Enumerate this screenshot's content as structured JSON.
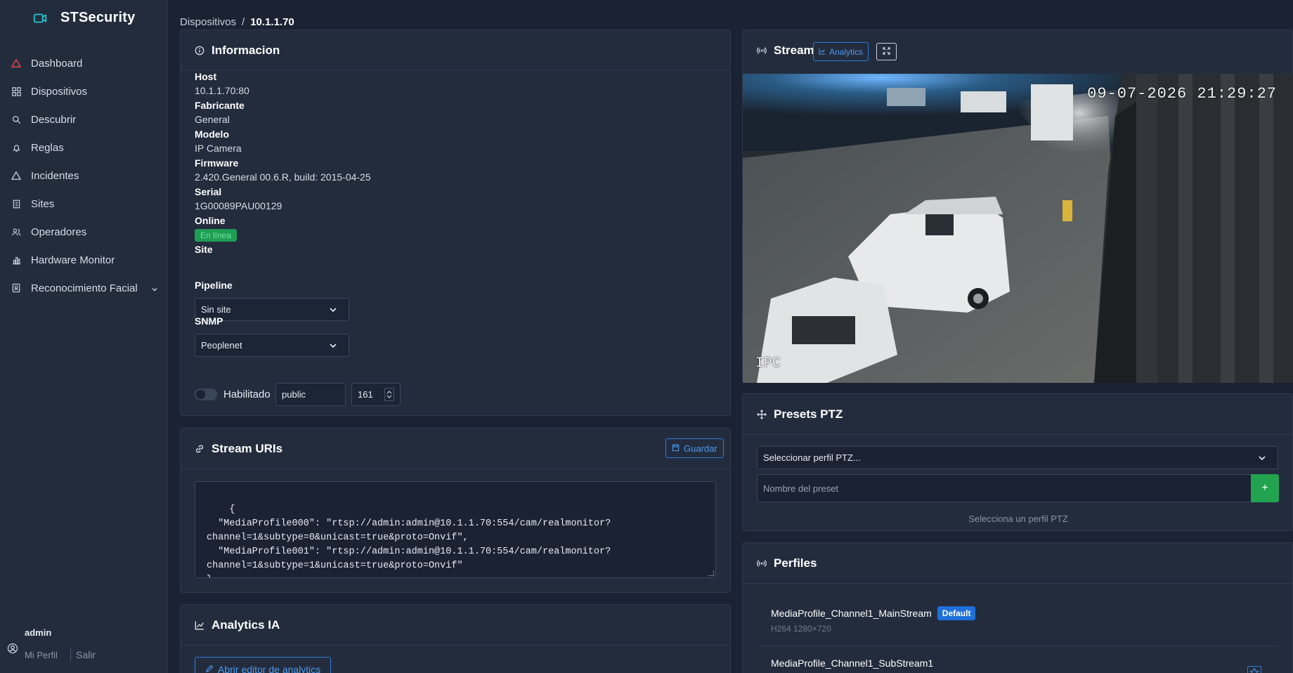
{
  "app": {
    "title": "STSecurity"
  },
  "sidebar": {
    "items": [
      {
        "label": "Dashboard",
        "icon": "alert-triangle-icon"
      },
      {
        "label": "Dispositivos",
        "icon": "grid-icon"
      },
      {
        "label": "Descubrir",
        "icon": "search-icon"
      },
      {
        "label": "Reglas",
        "icon": "bell-icon"
      },
      {
        "label": "Incidentes",
        "icon": "warning-icon"
      },
      {
        "label": "Sites",
        "icon": "building-icon"
      },
      {
        "label": "Operadores",
        "icon": "users-icon"
      },
      {
        "label": "Hardware Monitor",
        "icon": "chart-bar-icon"
      },
      {
        "label": "Reconocimiento Facial",
        "icon": "id-card-icon"
      }
    ],
    "user": {
      "name": "admin",
      "profile": "Mi Perfil",
      "logout": "Salir"
    }
  },
  "breadcrumb": {
    "parent": "Dispositivos",
    "separator": "/",
    "current": "10.1.1.70"
  },
  "info": {
    "title": "Informacion",
    "fields": [
      {
        "label": "Host",
        "value": "10.1.1.70:80"
      },
      {
        "label": "Fabricante",
        "value": "General"
      },
      {
        "label": "Modelo",
        "value": "IP Camera"
      },
      {
        "label": "Firmware",
        "value": "2.420.General 00.6.R, build: 2015-04-25"
      },
      {
        "label": "Serial",
        "value": "1G00089PAU00129"
      }
    ],
    "online": {
      "label": "Online",
      "badge": "En línea"
    },
    "site": {
      "label": "Site",
      "value": "Sin site"
    },
    "pipeline": {
      "label": "Pipeline",
      "value": "Peoplenet"
    },
    "snmp": {
      "label": "SNMP",
      "toggle_label": "Habilitado",
      "community": "public",
      "port": "161"
    }
  },
  "uris": {
    "title": "Stream URIs",
    "save_label": "Guardar",
    "content": "{\n  \"MediaProfile000\": \"rtsp://admin:admin@10.1.1.70:554/cam/realmonitor?\nchannel=1&subtype=0&unicast=true&proto=Onvif\",\n  \"MediaProfile001\": \"rtsp://admin:admin@10.1.1.70:554/cam/realmonitor?\nchannel=1&subtype=1&unicast=true&proto=Onvif\"\n}"
  },
  "analytics": {
    "title": "Analytics IA",
    "button": "Abrir editor de analytics"
  },
  "stream": {
    "title": "Stream",
    "analytics_button": "Analytics",
    "timestamp": "09-07-2026 21:29:27",
    "overlay": "IPC"
  },
  "ptz": {
    "title": "Presets PTZ",
    "profile_placeholder": "Seleccionar perfil PTZ...",
    "preset_placeholder": "Nombre del preset",
    "add_label": "+",
    "hint": "Selecciona un perfil PTZ"
  },
  "profiles": {
    "title": "Perfiles",
    "items": [
      {
        "name": "MediaProfile_Channel1_MainStream",
        "badge": "Default",
        "meta": "H264 1280×720"
      },
      {
        "name": "MediaProfile_Channel1_SubStream1"
      }
    ]
  },
  "colors": {
    "accent": "#2f7bd6",
    "success": "#22a34f",
    "brand_icon": "#22c3c9",
    "danger": "#e5484d"
  }
}
